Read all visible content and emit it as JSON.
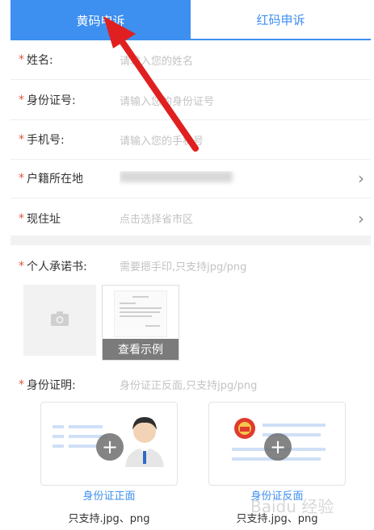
{
  "tabs": [
    {
      "label": "黄码申诉",
      "active": true
    },
    {
      "label": "红码申诉",
      "active": false
    }
  ],
  "required_mark": "*",
  "fields": [
    {
      "label": "姓名:",
      "placeholder": "请输入您的姓名"
    },
    {
      "label": "身份证号:",
      "placeholder": "请输入您的身份证号"
    },
    {
      "label": "手机号:",
      "placeholder": "请输入您的手机号"
    },
    {
      "label": "户籍所在地",
      "placeholder": ""
    },
    {
      "label": "现住址",
      "placeholder": "点击选择省市区"
    }
  ],
  "pledge": {
    "label": "个人承诺书:",
    "hint": "需要摁手印,只支持jpg/png",
    "example_label": "查看示例"
  },
  "id_proof": {
    "label": "身份证明:",
    "hint": "身份证正反面,只支持jpg/png",
    "front": {
      "caption": "身份证正面",
      "note": "只支持.jpg、png"
    },
    "back": {
      "caption": "身份证反面",
      "note": "只支持.jpg、png"
    }
  },
  "colors": {
    "accent": "#3d8ff0",
    "required": "#e0533d",
    "arrow": "#e02020"
  },
  "icons": [
    "camera-icon",
    "plus-icon",
    "chevron-right-icon",
    "avatar-icon",
    "emblem-icon"
  ],
  "watermark": "Baidu 经验"
}
